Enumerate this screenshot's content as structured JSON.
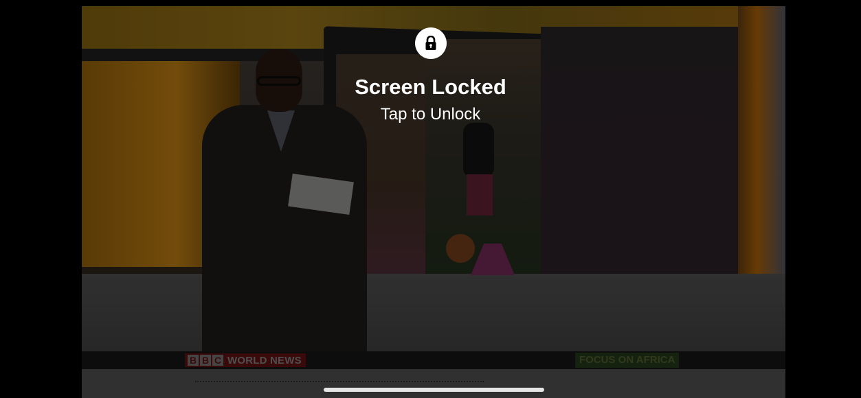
{
  "lock_overlay": {
    "icon": "lock-icon",
    "title": "Screen Locked",
    "subtitle": "Tap to Unlock"
  },
  "video": {
    "channel_logo_letters": [
      "B",
      "B",
      "C"
    ],
    "channel_name": "WORLD NEWS",
    "programme_tag": "FOCUS ON AFRICA"
  },
  "colors": {
    "lock_badge_bg": "#ffffff",
    "lock_icon": "#000000",
    "overlay_text": "#ffffff",
    "home_indicator": "#e6e6e6"
  }
}
